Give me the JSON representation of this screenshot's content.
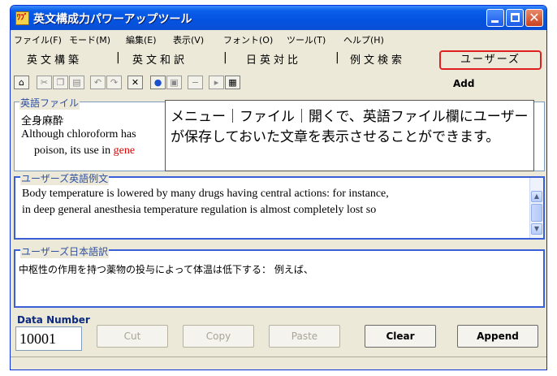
{
  "window": {
    "title": "英文構成力パワーアップツール",
    "app_icon_text": "ﾜﾌﾞ"
  },
  "menu": [
    "ファイル(F)",
    "モード(M)",
    "編集(E)",
    "表示(V)",
    "フォント(O)",
    "ツール(T)",
    "ヘルプ(H)"
  ],
  "mode_tabs": {
    "composition": "英文構築",
    "translation": "英文和訳",
    "compare": "日英対比",
    "search": "例文検索",
    "users": "ユーザーズ"
  },
  "toolbar": {
    "add_label": "Add"
  },
  "english_file": {
    "label": "英語ファイル",
    "line1": "全身麻酔",
    "line2": "Although chloroform has",
    "line3_start": "poison, its use in ",
    "line3_red": "gene"
  },
  "tooltip": {
    "text": "メニュー｜ファイル｜開くで、英語ファイル欄にユーザーが保存しておいた文章を表示させることができます。"
  },
  "user_english": {
    "label": "ユーザーズ英語例文",
    "line1": "Body temperature is lowered by many drugs having central actions: for instance,",
    "line2": "in deep general anesthesia temperature regulation is almost completely lost so"
  },
  "user_japanese": {
    "label": "ユーザーズ日本語訳",
    "line1": "中枢性の作用を持つ薬物の投与によって体温は低下する： 例えば、"
  },
  "data_number": {
    "label": "Data Number",
    "value": "10001"
  },
  "buttons": {
    "cut": "Cut",
    "copy": "Copy",
    "paste": "Paste",
    "clear": "Clear",
    "append": "Append"
  }
}
